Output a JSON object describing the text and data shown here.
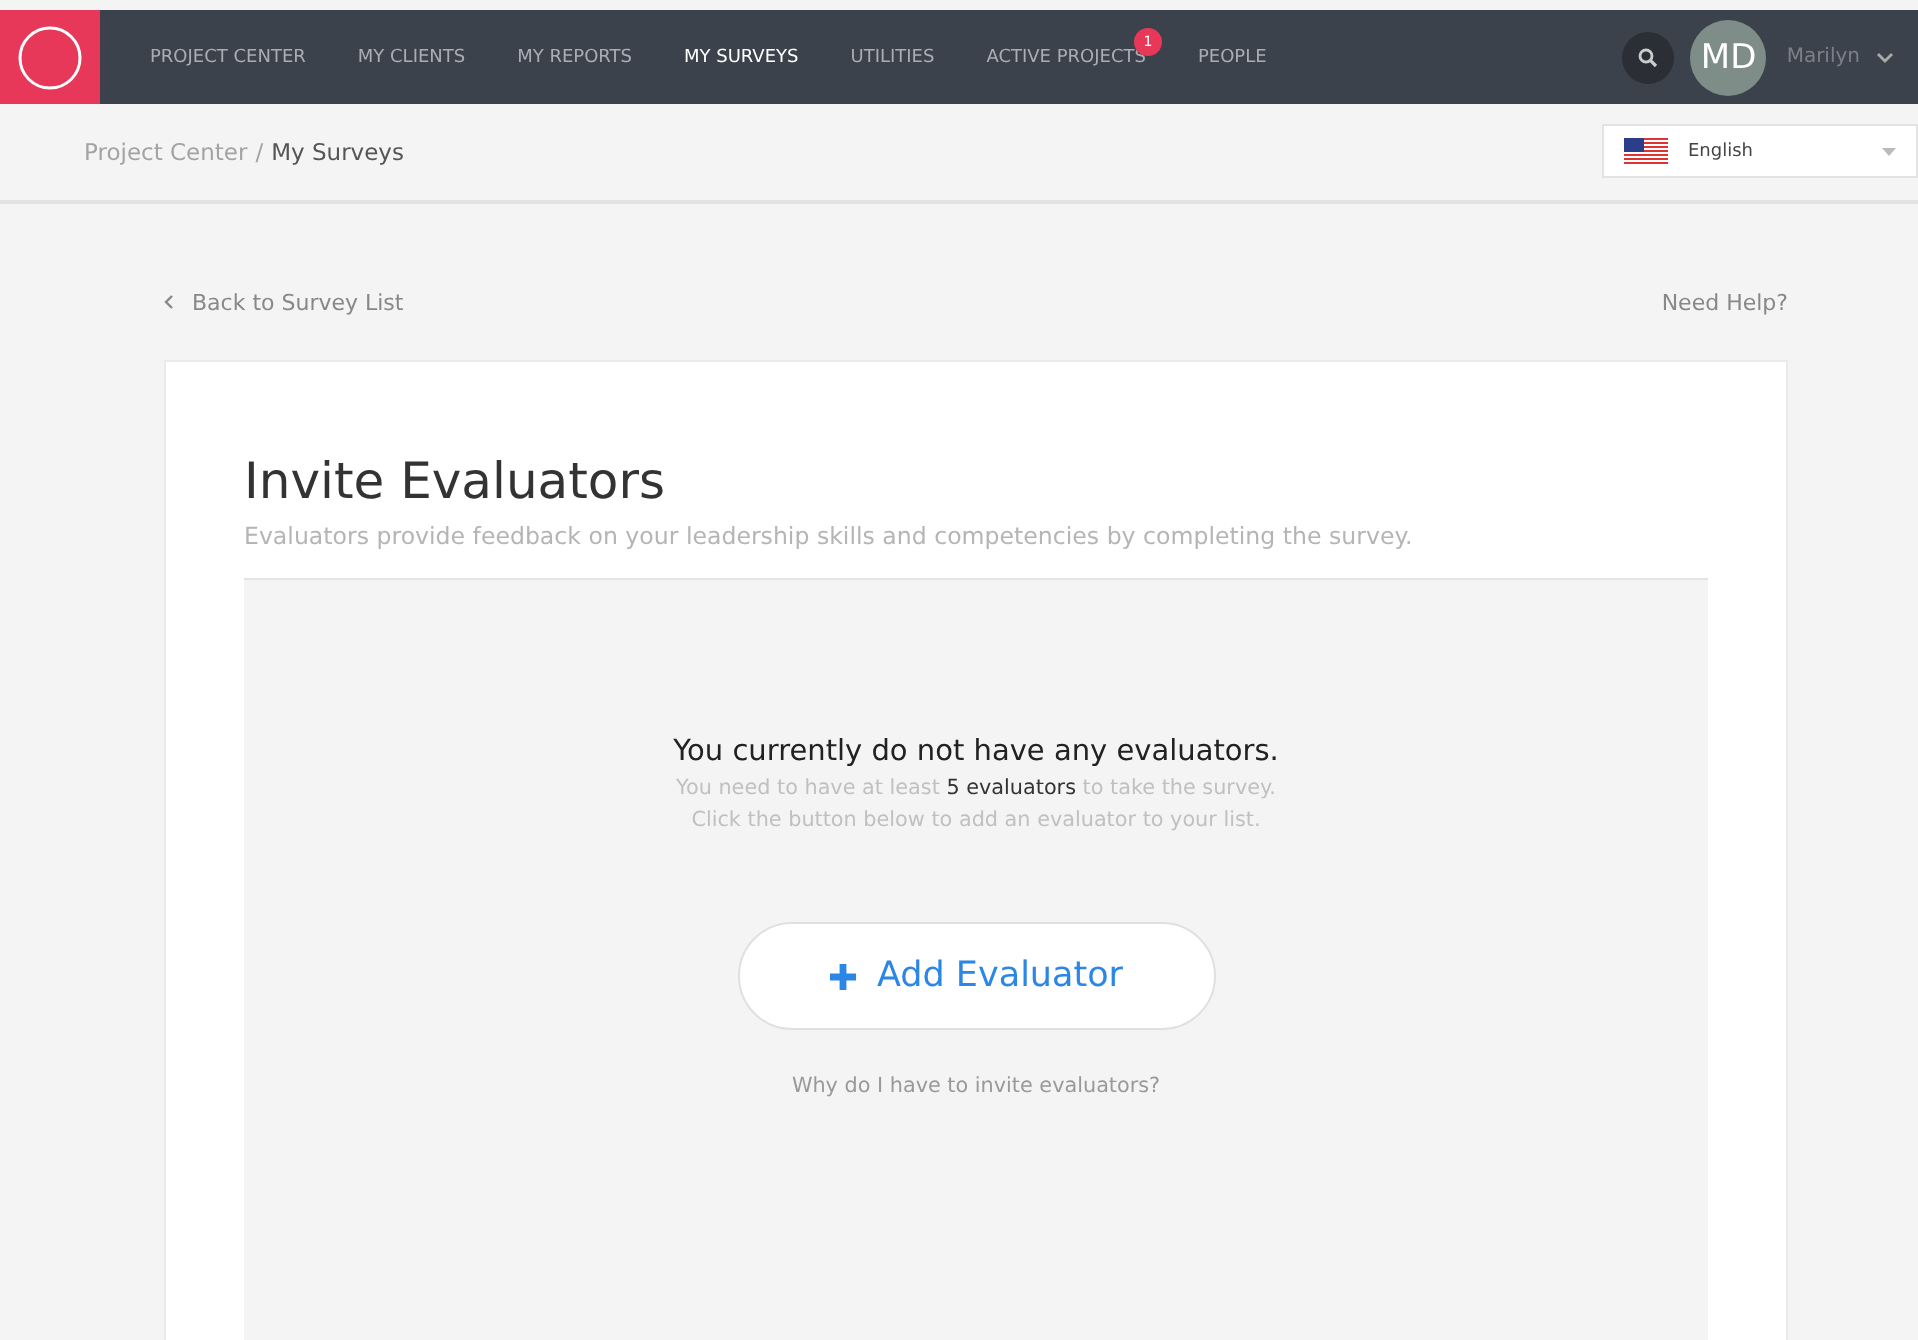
{
  "nav": {
    "items": [
      {
        "label": "PROJECT CENTER",
        "selected": false
      },
      {
        "label": "MY CLIENTS",
        "selected": false
      },
      {
        "label": "MY REPORTS",
        "selected": false
      },
      {
        "label": "MY SURVEYS",
        "selected": true
      },
      {
        "label": "UTILITIES",
        "selected": false
      },
      {
        "label": "ACTIVE PROJECTS",
        "selected": false,
        "badge": "1"
      },
      {
        "label": "PEOPLE",
        "selected": false
      }
    ],
    "avatar": "MD",
    "user": "Marilyn"
  },
  "breadcrumb": {
    "items": [
      "Project Center",
      "My Surveys"
    ],
    "separator": "/"
  },
  "language": {
    "value": "English"
  },
  "back_link": "Back to Survey List",
  "help_link": "Need Help?",
  "title": "Invite Evaluators",
  "subtitle": "Evaluators provide feedback on your leadership skills and competencies by completing the survey.",
  "empty": {
    "heading": "You currently do not have any evaluators.",
    "lines": [
      "You need to have at least **5 evaluators** to take the survey.",
      "Click the button below to add an evaluator to your list."
    ],
    "button": "Add Evaluator",
    "why_link": "Why do I have to invite evaluators?"
  }
}
